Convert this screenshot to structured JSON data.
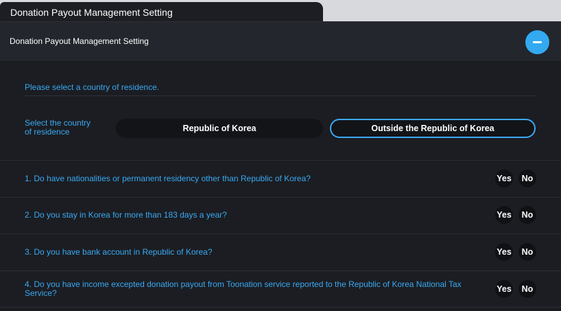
{
  "tab": {
    "title": "Donation Payout Management Setting"
  },
  "header": {
    "title": "Donation Payout Management Setting",
    "collapse_icon": "minus-icon"
  },
  "residence": {
    "prompt": "Please select a country of residence.",
    "label_line1": "Select the country",
    "label_line2": "of residence",
    "options": [
      "Republic of Korea",
      "Outside the Republic of Korea"
    ],
    "selected": "Outside the Republic of Korea"
  },
  "questions": [
    {
      "text": "1. Do have nationalities or permanent residency other than Republic of Korea?",
      "yes": "Yes",
      "no": "No"
    },
    {
      "text": "2. Do you stay in Korea for more than 183 days a year?",
      "yes": "Yes",
      "no": "No"
    },
    {
      "text": "3. Do you have bank account in Republic of Korea?",
      "yes": "Yes",
      "no": "No"
    },
    {
      "text": "4. Do you have income excepted donation payout from Toonation service reported to the Republic of Korea National Tax Service?",
      "yes": "Yes",
      "no": "No"
    }
  ],
  "colors": {
    "accent": "#3aa9f2",
    "panel": "#1b1d22",
    "header": "#23262c"
  }
}
